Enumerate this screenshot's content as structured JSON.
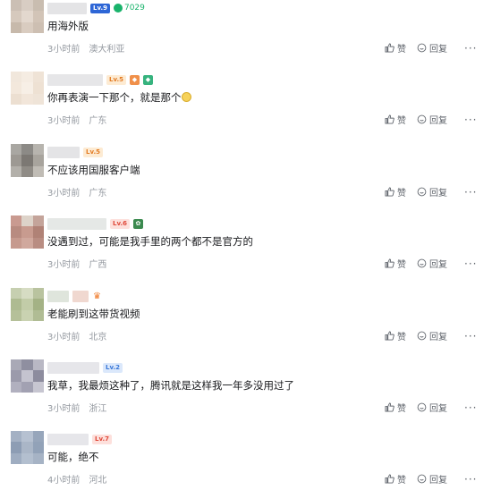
{
  "colors": {
    "text": "#18191c",
    "meta": "#9499a0",
    "action": "#61666d",
    "fans_green": "#19b36b"
  },
  "actions": {
    "like_label": "赞",
    "reply_label": "回复",
    "more_label": "···"
  },
  "comments": [
    {
      "text": "用海外版",
      "time": "3小时前",
      "location": "澳大利亚",
      "level": "Lv.9",
      "fans_count": "7029"
    },
    {
      "text": "你再表演一下那个，就是那个",
      "time": "3小时前",
      "location": "广东",
      "level": "Lv.5"
    },
    {
      "text": "不应该用国服客户端",
      "time": "3小时前",
      "location": "广东",
      "level": "Lv.5"
    },
    {
      "text": "没遇到过，可能是我手里的两个都不是官方的",
      "time": "3小时前",
      "location": "广西",
      "level": "Lv.6"
    },
    {
      "text": "老能刷到这带货视频",
      "time": "3小时前",
      "location": "北京"
    },
    {
      "text": "我草，我最烦这种了，腾讯就是这样我一年多没用过了",
      "time": "3小时前",
      "location": "浙江",
      "level": "Lv.2"
    },
    {
      "text": "可能，绝不",
      "time": "4小时前",
      "location": "河北",
      "level": "Lv.7"
    }
  ]
}
